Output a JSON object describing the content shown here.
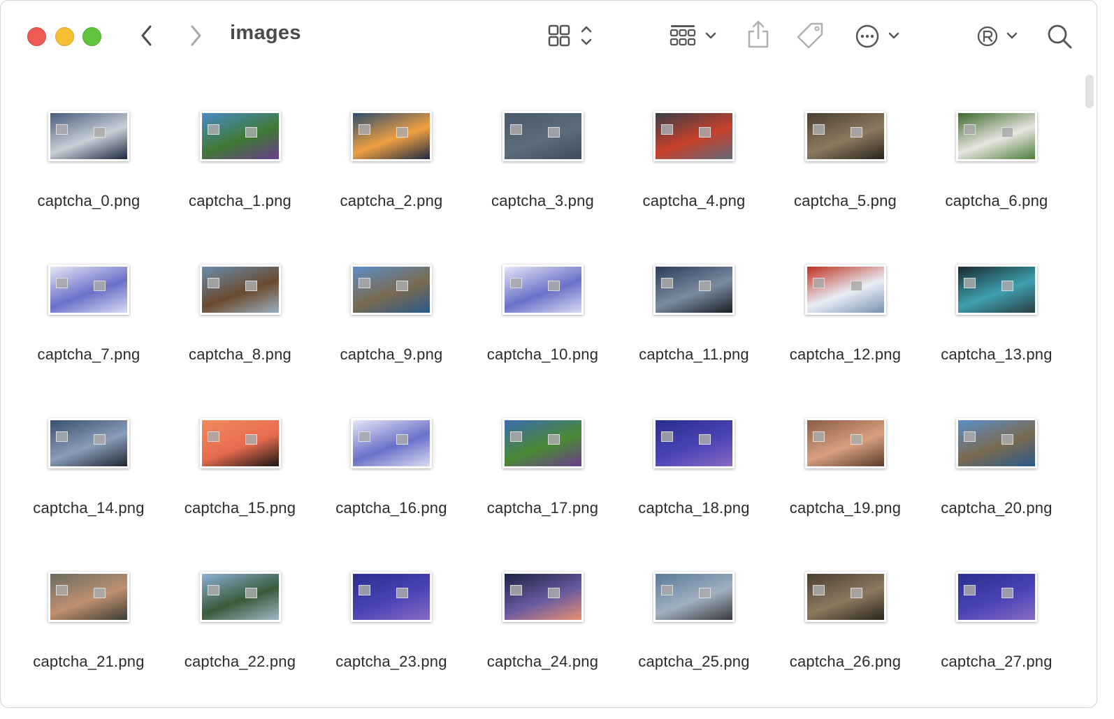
{
  "window": {
    "title": "images"
  },
  "toolbar": {
    "back_icon": "chevron-left-icon",
    "forward_icon": "chevron-right-icon",
    "view_icon": "grid-view-icon",
    "group_icon": "group-by-icon",
    "share_icon": "share-icon",
    "tag_icon": "tag-icon",
    "more_icon": "ellipsis-circle-icon",
    "registered_icon": "registered-icon",
    "search_icon": "search-icon"
  },
  "files": [
    {
      "name": "captcha_0.png",
      "colors": [
        "#4a5c7a",
        "#c8d0d8",
        "#1c2840"
      ]
    },
    {
      "name": "captcha_1.png",
      "colors": [
        "#4a8ac8",
        "#3f7a34",
        "#6a3c8c"
      ]
    },
    {
      "name": "captcha_2.png",
      "colors": [
        "#2c4c6e",
        "#f0a040",
        "#1e2a44"
      ]
    },
    {
      "name": "captcha_3.png",
      "colors": [
        "#4a5a6a",
        "#5c6c7a",
        "#3e4c5a"
      ]
    },
    {
      "name": "captcha_4.png",
      "colors": [
        "#3a3e46",
        "#c8402c",
        "#606a78"
      ]
    },
    {
      "name": "captcha_5.png",
      "colors": [
        "#4a3e30",
        "#8c7a60",
        "#2a241c"
      ]
    },
    {
      "name": "captcha_6.png",
      "colors": [
        "#3e6a2e",
        "#e8e6e0",
        "#4a7e38"
      ]
    },
    {
      "name": "captcha_7.png",
      "colors": [
        "#e4e6f6",
        "#6a70c8",
        "#d8dcf2"
      ]
    },
    {
      "name": "captcha_8.png",
      "colors": [
        "#6a8cae",
        "#6a4a2e",
        "#9cb0c0"
      ]
    },
    {
      "name": "captcha_9.png",
      "colors": [
        "#5c8ec8",
        "#7a6a50",
        "#2a5a8a"
      ]
    },
    {
      "name": "captcha_10.png",
      "colors": [
        "#e4e6f6",
        "#6a70c8",
        "#d8dcf2"
      ]
    },
    {
      "name": "captcha_11.png",
      "colors": [
        "#2c3c5a",
        "#7a8ca0",
        "#1a1e26"
      ]
    },
    {
      "name": "captcha_12.png",
      "colors": [
        "#c0301e",
        "#e8eef6",
        "#7a90b0"
      ]
    },
    {
      "name": "captcha_13.png",
      "colors": [
        "#1a2a2e",
        "#3ea0b0",
        "#2a3e40"
      ]
    },
    {
      "name": "captcha_14.png",
      "colors": [
        "#3a5070",
        "#8a9cb8",
        "#1e2630"
      ]
    },
    {
      "name": "captcha_15.png",
      "colors": [
        "#f08a5c",
        "#e86a50",
        "#1a1614"
      ]
    },
    {
      "name": "captcha_16.png",
      "colors": [
        "#e4e6f6",
        "#6a70c8",
        "#d8dcf2"
      ]
    },
    {
      "name": "captcha_17.png",
      "colors": [
        "#3a6ab0",
        "#4a8a34",
        "#6a3c8c"
      ]
    },
    {
      "name": "captcha_18.png",
      "colors": [
        "#2a2e8c",
        "#4a44b8",
        "#8a6ac0"
      ]
    },
    {
      "name": "captcha_19.png",
      "colors": [
        "#8a5c44",
        "#d8a080",
        "#5a3a2a"
      ]
    },
    {
      "name": "captcha_20.png",
      "colors": [
        "#5c8ec8",
        "#7a6a50",
        "#2a5a8a"
      ]
    },
    {
      "name": "captcha_21.png",
      "colors": [
        "#6a6c60",
        "#c09070",
        "#3a3c34"
      ]
    },
    {
      "name": "captcha_22.png",
      "colors": [
        "#8ab0d8",
        "#3a5a3a",
        "#a0b8c8"
      ]
    },
    {
      "name": "captcha_23.png",
      "colors": [
        "#2a2e8c",
        "#4a44b8",
        "#8a6ac0"
      ]
    },
    {
      "name": "captcha_24.png",
      "colors": [
        "#1a2244",
        "#6a5aa0",
        "#e89070"
      ]
    },
    {
      "name": "captcha_25.png",
      "colors": [
        "#5a7a9a",
        "#a0b0c0",
        "#3a3a3e"
      ]
    },
    {
      "name": "captcha_26.png",
      "colors": [
        "#4a3e30",
        "#8c7a60",
        "#2a241c"
      ]
    },
    {
      "name": "captcha_27.png",
      "colors": [
        "#2a2e8c",
        "#4a44b8",
        "#8a6ac0"
      ]
    }
  ]
}
